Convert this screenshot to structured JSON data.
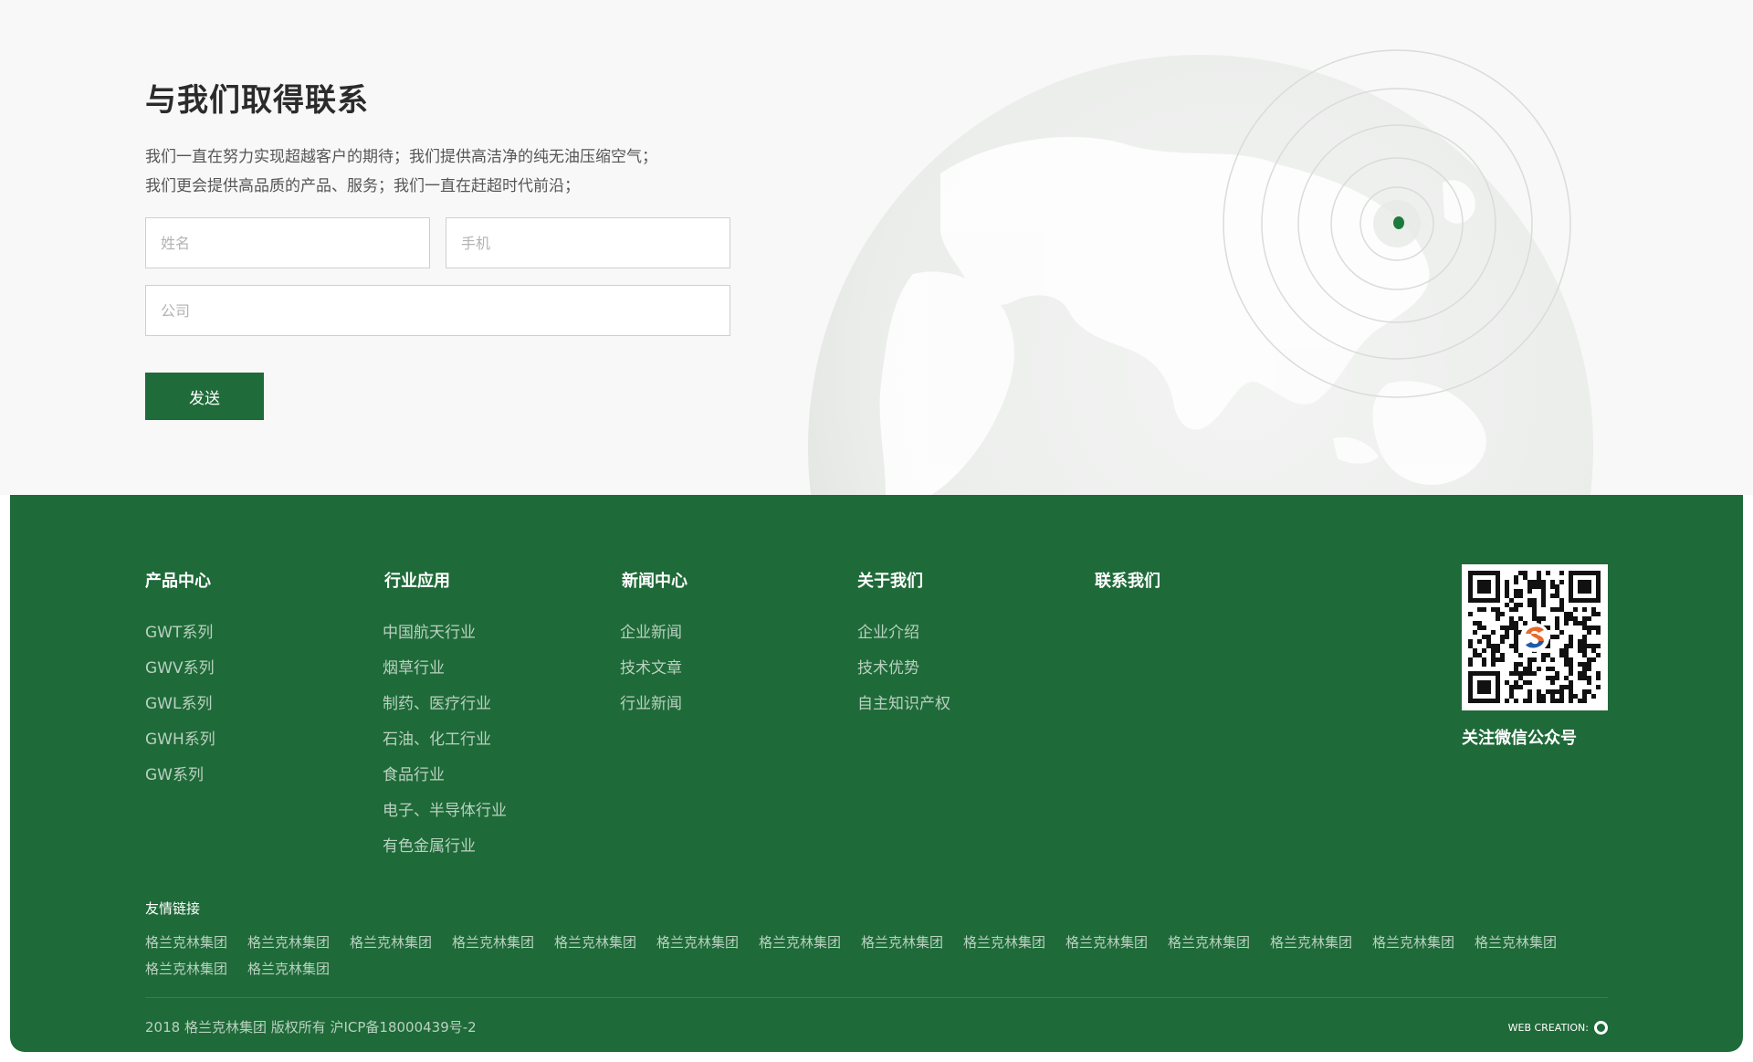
{
  "contact": {
    "title": "与我们取得联系",
    "desc_line1": "我们一直在努力实现超越客户的期待；我们提供高洁净的纯无油压缩空气；",
    "desc_line2": "我们更会提供高品质的产品、服务；我们一直在赶超时代前沿；",
    "name_placeholder": "姓名",
    "phone_placeholder": "手机",
    "company_placeholder": "公司",
    "send_label": "发送"
  },
  "colors": {
    "brand_green": "#1f6a39",
    "button_green": "#1f6b3a",
    "map_dot": "#1d7a3e"
  },
  "footer": {
    "columns": [
      {
        "title": "产品中心",
        "items": [
          "GWT系列",
          "GWV系列",
          "GWL系列",
          "GWH系列",
          "GW系列"
        ]
      },
      {
        "title": "行业应用",
        "items": [
          "中国航天行业",
          "烟草行业",
          "制药、医疗行业",
          "石油、化工行业",
          "食品行业",
          "电子、半导体行业",
          "有色金属行业"
        ]
      },
      {
        "title": "新闻中心",
        "items": [
          "企业新闻",
          "技术文章",
          "行业新闻"
        ]
      },
      {
        "title": "关于我们",
        "items": [
          "企业介绍",
          "技术优势",
          "自主知识产权"
        ]
      },
      {
        "title": "联系我们",
        "items": []
      }
    ],
    "qr_label": "关注微信公众号",
    "links_title": "友情链接",
    "links": [
      "格兰克林集团",
      "格兰克林集团",
      "格兰克林集团",
      "格兰克林集团",
      "格兰克林集团",
      "格兰克林集团",
      "格兰克林集团",
      "格兰克林集团",
      "格兰克林集团",
      "格兰克林集团",
      "格兰克林集团",
      "格兰克林集团",
      "格兰克林集团",
      "格兰克林集团",
      "格兰克林集团",
      "格兰克林集团"
    ],
    "copyright": "2018 格兰克林集团 版权所有 沪ICP备18000439号-2",
    "web_creation": "WEB CREATION:"
  }
}
